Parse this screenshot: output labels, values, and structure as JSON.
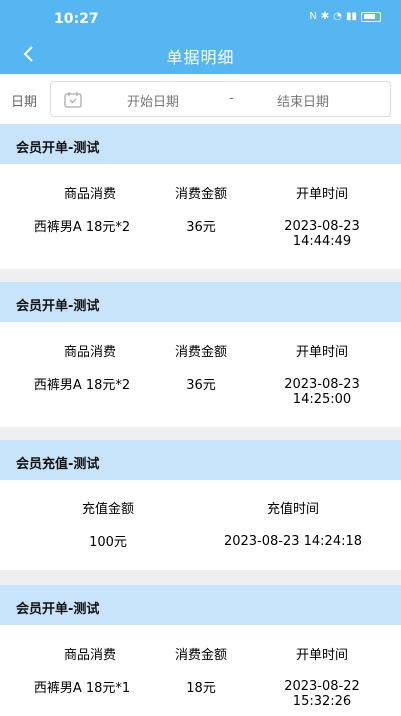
{
  "status_bar": {
    "time": "10:27",
    "icons": [
      "nfc-icon",
      "bluetooth-icon",
      "wifi-icon",
      "signal-icon",
      "battery-icon"
    ]
  },
  "nav": {
    "title": "单据明细"
  },
  "date_filter": {
    "label": "日期",
    "start_placeholder": "开始日期",
    "separator": "-",
    "end_placeholder": "结束日期"
  },
  "colors": {
    "header": "#55b6f2",
    "card_header": "#c7e4fb"
  },
  "records": [
    {
      "title": "会员开单-测试",
      "headers": [
        "商品消费",
        "消费金额",
        "开单时间"
      ],
      "values": [
        "西裤男A 18元*2",
        "36元",
        "2023-08-23",
        "14:44:49"
      ]
    },
    {
      "title": "会员开单-测试",
      "headers": [
        "商品消费",
        "消费金额",
        "开单时间"
      ],
      "values": [
        "西裤男A 18元*2",
        "36元",
        "2023-08-23",
        "14:25:00"
      ]
    },
    {
      "title": "会员充值-测试",
      "headers": [
        "充值金额",
        "充值时间"
      ],
      "values": [
        "100元",
        "2023-08-23 14:24:18"
      ]
    },
    {
      "title": "会员开单-测试",
      "headers": [
        "商品消费",
        "消费金额",
        "开单时间"
      ],
      "values": [
        "西裤男A 18元*1",
        "18元",
        "2023-08-22",
        "15:32:26"
      ]
    }
  ]
}
